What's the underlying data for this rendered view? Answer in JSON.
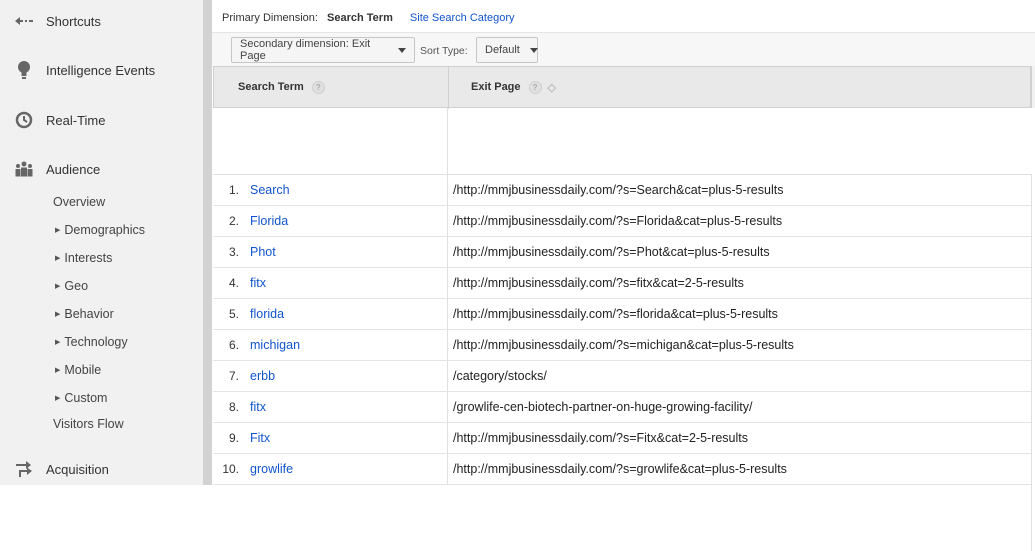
{
  "sidebar": {
    "items": [
      {
        "label": "Shortcuts",
        "icon": "back-arrow-icon"
      },
      {
        "label": "Intelligence Events",
        "icon": "lightbulb-icon"
      },
      {
        "label": "Real-Time",
        "icon": "clock-icon"
      },
      {
        "label": "Audience",
        "icon": "people-icon"
      },
      {
        "label": "Acquisition",
        "icon": "acquisition-icon"
      }
    ],
    "audience_sub": {
      "overview": "Overview",
      "demographics": "Demographics",
      "interests": "Interests",
      "geo": "Geo",
      "behavior": "Behavior",
      "technology": "Technology",
      "mobile": "Mobile",
      "custom": "Custom",
      "visitors_flow": "Visitors Flow"
    }
  },
  "main": {
    "primary_label": "Primary Dimension:",
    "primary_active": "Search Term",
    "primary_link": "Site Search Category",
    "secondary_dimension": "Secondary dimension: Exit Page",
    "sort_type_label": "Sort Type:",
    "sort_type_value": "Default"
  },
  "table": {
    "headers": {
      "search_term": "Search Term",
      "exit_page": "Exit Page",
      "help": "?",
      "sort_glyph": "◇"
    },
    "rows": [
      {
        "num": "1.",
        "term": "Search",
        "page": "/http://mmjbusinessdaily.com/?s=Search&cat=plus-5-results"
      },
      {
        "num": "2.",
        "term": "Florida",
        "page": "/http://mmjbusinessdaily.com/?s=Florida&cat=plus-5-results"
      },
      {
        "num": "3.",
        "term": "Phot",
        "page": "/http://mmjbusinessdaily.com/?s=Phot&cat=plus-5-results"
      },
      {
        "num": "4.",
        "term": "fitx",
        "page": "/http://mmjbusinessdaily.com/?s=fitx&cat=2-5-results"
      },
      {
        "num": "5.",
        "term": "florida",
        "page": "/http://mmjbusinessdaily.com/?s=florida&cat=plus-5-results"
      },
      {
        "num": "6.",
        "term": "michigan",
        "page": "/http://mmjbusinessdaily.com/?s=michigan&cat=plus-5-results"
      },
      {
        "num": "7.",
        "term": "erbb",
        "page": "/category/stocks/"
      },
      {
        "num": "8.",
        "term": "fitx",
        "page": "/growlife-cen-biotech-partner-on-huge-growing-facility/"
      },
      {
        "num": "9.",
        "term": "Fitx",
        "page": "/http://mmjbusinessdaily.com/?s=Fitx&cat=2-5-results"
      },
      {
        "num": "10.",
        "term": "growlife",
        "page": "/http://mmjbusinessdaily.com/?s=growlife&cat=plus-5-results"
      }
    ]
  },
  "colors": {
    "link": "#1155cc",
    "sidebar_bg": "#f1f1f1",
    "header_bg": "#e9e9e9"
  }
}
